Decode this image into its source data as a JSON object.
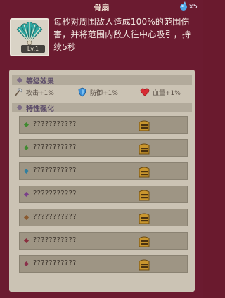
{
  "header": {
    "title": "骨扇",
    "currency_icon": "blue-gem-icon",
    "currency_count": "x5"
  },
  "skill": {
    "icon": "bone-fan-icon",
    "level": "Lv.1",
    "description": "每秒对周围敌人造成100%的范围伤害，并将范围内敌人往中心吸引，持续5秒"
  },
  "level_effects": {
    "title": "等级效果",
    "stats": [
      {
        "icon": "axe-icon",
        "label": "攻击+1%"
      },
      {
        "icon": "shield-icon",
        "label": "防御+1%"
      },
      {
        "icon": "heart-icon",
        "label": "血量+1%"
      }
    ]
  },
  "enhancement": {
    "title": "特性强化",
    "rows": [
      {
        "text": "???????????",
        "bullet_color": "#3f8a2f",
        "icon": "locked-chest-icon"
      },
      {
        "text": "???????????",
        "bullet_color": "#3f8a2f",
        "icon": "locked-chest-icon"
      },
      {
        "text": "???????????",
        "bullet_color": "#2f7fa0",
        "icon": "locked-chest-icon"
      },
      {
        "text": "???????????",
        "bullet_color": "#7a3f8a",
        "icon": "locked-chest-icon"
      },
      {
        "text": "???????????",
        "bullet_color": "#8a5a2f",
        "icon": "locked-chest-icon"
      },
      {
        "text": "???????????",
        "bullet_color": "#8a2f3f",
        "icon": "locked-chest-icon"
      },
      {
        "text": "???????????",
        "bullet_color": "#8a2f4a",
        "icon": "locked-chest-icon"
      }
    ]
  },
  "colors": {
    "background": "#6b1b30",
    "card": "#cbc3b4",
    "row": "#9e9584",
    "accent_gold": "#c9962e"
  }
}
